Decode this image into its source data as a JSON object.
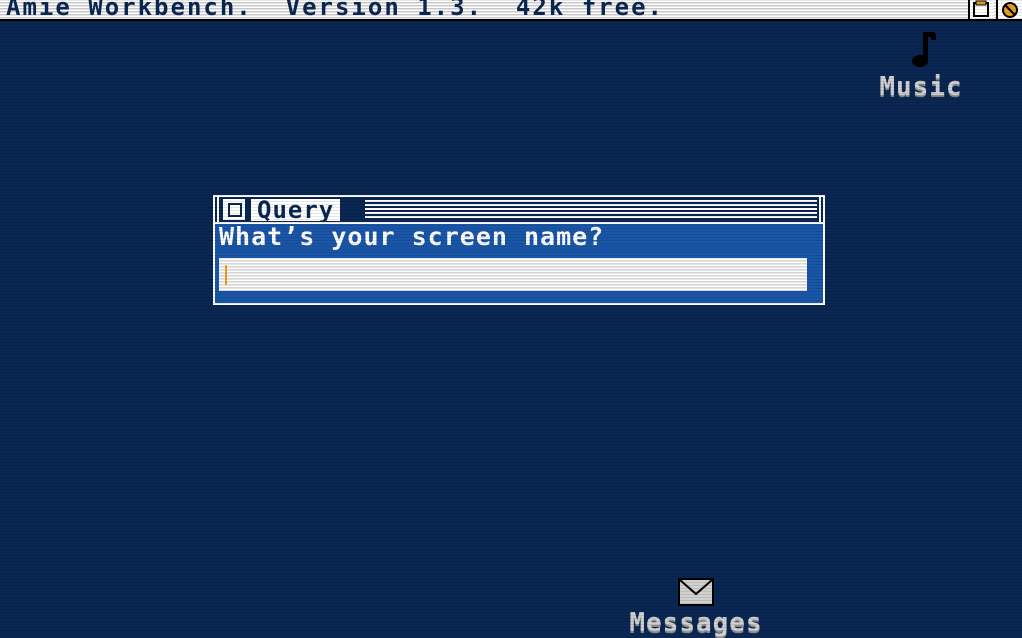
{
  "screen": {
    "title": "Amie Workbench.  Version 1.3.  42k free.",
    "background_color": "#0a2652"
  },
  "desktop_icons": [
    {
      "label": "Music",
      "icon": "music-note-icon"
    },
    {
      "label": "Messages",
      "icon": "envelope-icon"
    }
  ],
  "query_window": {
    "title": "Query",
    "prompt": "What’s your screen name?",
    "input_value": "",
    "accent_color": "#1a56a8",
    "caret_color": "#e8a020"
  }
}
